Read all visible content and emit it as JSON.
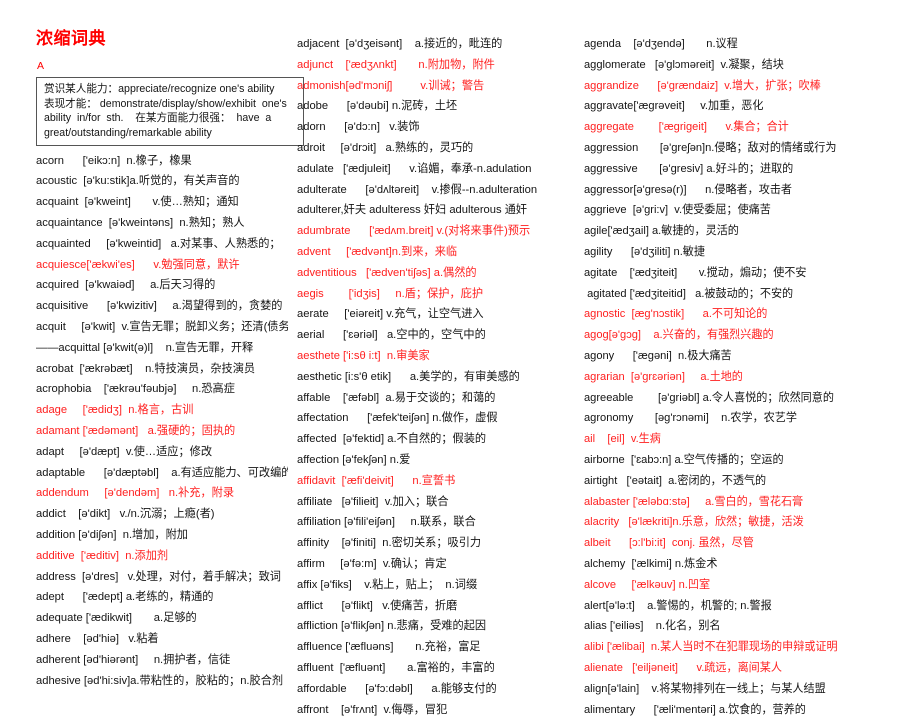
{
  "document": {
    "title": "浓缩词典",
    "section_letter": "A",
    "note_box": {
      "lines": [
        "赏识某人能力：appreciate/recognize one's ability",
        "表现才能： demonstrate/display/show/exhibit  one's",
        "ability  in/for  sth.    在某方面能力很强：  have  a",
        "great/outstanding/remarkable ability"
      ]
    }
  },
  "columns": [
    {
      "id": "column-1",
      "entries": [
        {
          "text": "acorn      ['eikɔ:n]  n.橡子，橡果",
          "red": false
        },
        {
          "text": "acoustic  [ə'ku:stik]a.听觉的，有关声音的",
          "red": false
        },
        {
          "text": "acquaint  [ə'kweint]       v.使…熟知；通知",
          "red": false
        },
        {
          "text": "acquaintance  [ə'kweintəns]  n.熟知；熟人",
          "red": false
        },
        {
          "text": "acquainted     [ə'kweintid]   a.对某事、人熟悉的；",
          "red": false
        },
        {
          "text": "acquiesce['ækwi'es]      v.勉强同意，默许",
          "red": true
        },
        {
          "text": "acquired  [ə'kwaiəd]     a.后天习得的",
          "red": false
        },
        {
          "text": "acquisitive      [ə'kwizitiv]     a.渴望得到的，贪婪的",
          "red": false
        },
        {
          "text": "acquit     [ə'kwit]  v.宣告无罪；脱卸义务；还清(债务)",
          "red": false
        },
        {
          "text": "——acquittal [ə'kwit(ə)l]    n.宣告无罪，开释",
          "red": false
        },
        {
          "text": "acrobat  ['ækrəbæt]    n.特技演员，杂技演员",
          "red": false
        },
        {
          "text": "acrophobia    ['ækrəu'fəubjə]     n.恐高症",
          "red": false
        },
        {
          "text": "adage     ['ædidʒ]  n.格言，古训",
          "red": true
        },
        {
          "text": "adamant ['ædəmənt]   a.强硬的；固执的",
          "red": true
        },
        {
          "text": "adapt     [ə'dæpt]  v.使…适应；修改",
          "red": false
        },
        {
          "text": "adaptable      [ə'dæptəbl]    a.有适应能力、可改编的",
          "red": false
        },
        {
          "text": "addendum     [ə'dendəm]   n.补充，附录",
          "red": true
        },
        {
          "text": "addict    [ə'dikt]   v./n.沉溺；上瘾(者)",
          "red": false
        },
        {
          "text": "addition [ə'diʃən]  n.增加，附加",
          "red": false
        },
        {
          "text": "additive  ['æditiv]  n.添加剂",
          "red": true
        },
        {
          "text": "address  [ə'dres]   v.处理，对付，着手解决；致词",
          "red": false
        },
        {
          "text": "adept      ['ædept] a.老练的，精通的",
          "red": false
        },
        {
          "text": "adequate ['ædikwit]       a.足够的",
          "red": false
        },
        {
          "text": "adhere    [əd'hiə]   v.粘着",
          "red": false
        },
        {
          "text": "adherent [əd'hiərənt]     n.拥护者，信徒",
          "red": false
        },
        {
          "text": "adhesive [əd'hi:siv]a.带粘性的，胶粘的；n.胶合剂",
          "red": false
        }
      ]
    },
    {
      "id": "column-2",
      "entries": [
        {
          "text": "adjacent  [ə'dʒeisənt]    a.接近的，毗连的",
          "red": false
        },
        {
          "text": "adjunct    ['ædʒʌnkt]       n.附加物，附件",
          "red": true
        },
        {
          "text": "admonish[əd'mɔniʃ]         v.训诫；警告",
          "red": true
        },
        {
          "text": "adobe      [ə'dəubi] n.泥砖，土坯",
          "red": false
        },
        {
          "text": "adorn      [ə'dɔ:n]   v.装饰",
          "red": false
        },
        {
          "text": "adroit     [ə'drɔit]   a.熟练的，灵巧的",
          "red": false
        },
        {
          "text": "adulate   ['ædjuleit]      v.谄媚，奉承-n.adulation",
          "red": false
        },
        {
          "text": "adulterate      [ə'dʌltəreit]    v.掺假--n.adulteration",
          "red": false
        },
        {
          "text": "adulterer,奸夫 adulteress 奸妇 adulterous 通奸",
          "red": false
        },
        {
          "text": "adumbrate      ['ædʌm.breit] v.(对将来事件)预示",
          "red": true
        },
        {
          "text": "advent     ['ædvənt]n.到来，来临",
          "red": true
        },
        {
          "text": "adventitious   ['ædven'tiʃəs] a.偶然的",
          "red": true
        },
        {
          "text": "aegis        ['idʒis]     n.盾；保护，庇护",
          "red": true
        },
        {
          "text": "aerate     ['eiəreit] v.充气，让空气进入",
          "red": false
        },
        {
          "text": "aerial      ['ɛəriəl]   a.空中的，空气中的",
          "red": false
        },
        {
          "text": "aesthete ['i:sθ i:t]  n.审美家",
          "red": true
        },
        {
          "text": "aesthetic [i:s'θ etik]      a.美学的，有审美感的",
          "red": false
        },
        {
          "text": "affable    ['æfəbl]  a.易于交谈的；和蔼的",
          "red": false
        },
        {
          "text": "affectation      ['æfek'teiʃən] n.做作，虚假",
          "red": false
        },
        {
          "text": "affected  [ə'fektid] a.不自然的；假装的",
          "red": false
        },
        {
          "text": "affection [ə'fekʃən] n.爱",
          "red": false
        },
        {
          "text": "affidavit  ['æfi'deivit]      n.宣誓书",
          "red": true
        },
        {
          "text": "affiliate   [ə'filieit]  v.加入；联合",
          "red": false
        },
        {
          "text": "affiliation [ə'fili'eiʃən]     n.联系，联合",
          "red": false
        },
        {
          "text": "affinity    [ə'finiti]  n.密切关系；吸引力",
          "red": false
        },
        {
          "text": "affirm     [ə'fə:m]  v.确认；肯定",
          "red": false
        },
        {
          "text": "affix [ə'fiks]    v.粘上，贴上；  n.词缀",
          "red": false
        },
        {
          "text": "afflict      [ə'flikt]   v.使痛苦，折磨",
          "red": false
        },
        {
          "text": "affliction [ə'flikʃən] n.悲痛，受难的起因",
          "red": false
        },
        {
          "text": "affluence ['æfluəns]       n.充裕，富足",
          "red": false
        },
        {
          "text": "affluent  ['æfluənt]       a.富裕的，丰富的",
          "red": false
        },
        {
          "text": "affordable      [ə'fɔ:dəbl]      a.能够支付的",
          "red": false
        },
        {
          "text": "affront    [ə'frʌnt]  v.侮辱，冒犯",
          "red": false
        }
      ]
    },
    {
      "id": "column-3",
      "entries": [
        {
          "text": "agenda    [ə'dʒendə]       n.议程",
          "red": false
        },
        {
          "text": "agglomerate   [ə'glɔməreit]  v.凝聚，结块",
          "red": false
        },
        {
          "text": "aggrandize      [ə'grændaiz]  v.增大，扩张；吹棒",
          "red": true
        },
        {
          "text": "aggravate['ægrəveit]     v.加重，恶化",
          "red": false
        },
        {
          "text": "aggregate        ['ægrigeit]      v.集合；合计",
          "red": true
        },
        {
          "text": "aggression       [ə'greʃən]n.侵略；敌对的情绪或行为",
          "red": false
        },
        {
          "text": "aggressive       [ə'gresiv] a.好斗的；进取的",
          "red": false
        },
        {
          "text": "aggressor[ə'gresə(r)]      n.侵略者，攻击者",
          "red": false
        },
        {
          "text": "aggrieve  [ə'gri:v]  v.使受委屈；使痛苦",
          "red": false
        },
        {
          "text": "agile['ædʒail] a.敏捷的，灵活的",
          "red": false
        },
        {
          "text": "agility      [ə'dʒiliti] n.敏捷",
          "red": false
        },
        {
          "text": "agitate    ['ædʒiteit]       v.搅动，煽动；使不安",
          "red": false
        },
        {
          "text": " agitated ['ædʒiteitid]   a.被鼓动的；不安的",
          "red": false
        },
        {
          "text": "agnostic  [æg'nɔstik]      a.不可知论的",
          "red": true
        },
        {
          "text": "agog[ə'gɔg]    a.兴奋的，有强烈兴趣的",
          "red": true
        },
        {
          "text": "agony      ['ægəni]  n.极大痛苦",
          "red": false
        },
        {
          "text": "agrarian  [ə'grɛəriən]     a.土地的",
          "red": true
        },
        {
          "text": "agreeable        [ə'griəbl] a.令人喜悦的；欣然同意的",
          "red": false
        },
        {
          "text": "agronomy       [əg'rɔnəmi]    n.农学，农艺学",
          "red": false
        },
        {
          "text": "ail    [eil]  v.生病",
          "red": true
        },
        {
          "text": "airborne  ['ɛabɔ:n] a.空气传播的；空运的",
          "red": false
        },
        {
          "text": "airtight   ['eətait]  a.密闭的，不透气的",
          "red": false
        },
        {
          "text": "alabaster ['æləbɑ:stə]     a.雪白的，雪花石膏",
          "red": true
        },
        {
          "text": "alacrity   [ə'lækriti]n.乐意，欣然；敏捷，活泼",
          "red": true
        },
        {
          "text": "albeit      [ɔ:l'bi:it]  conj. 虽然，尽管",
          "red": true
        },
        {
          "text": "alchemy  ['ælkimi] n.炼金术",
          "red": false
        },
        {
          "text": "alcove     ['ælkəuv] n.凹室",
          "red": true
        },
        {
          "text": "alert[ə'lə:t]    a.警惕的，机警的; n.警报",
          "red": false
        },
        {
          "text": "alias ['eiliəs]    n.化名，别名",
          "red": false
        },
        {
          "text": "alibi ['ælibai]  n.某人当时不在犯罪现场的申辩或证明",
          "red": true
        },
        {
          "text": "alienate   ['eiljəneit]      v.疏远，离间某人",
          "red": true
        },
        {
          "text": "align[ə'lain]    v.将某物排列在一线上；与某人结盟",
          "red": false
        },
        {
          "text": "alimentary      ['æli'mentəri] a.饮食的，营养的",
          "red": false
        }
      ]
    }
  ],
  "colors": {
    "highlight": "#ff2020",
    "title": "#ff0000",
    "text": "#141414",
    "box_border": "#555555"
  }
}
